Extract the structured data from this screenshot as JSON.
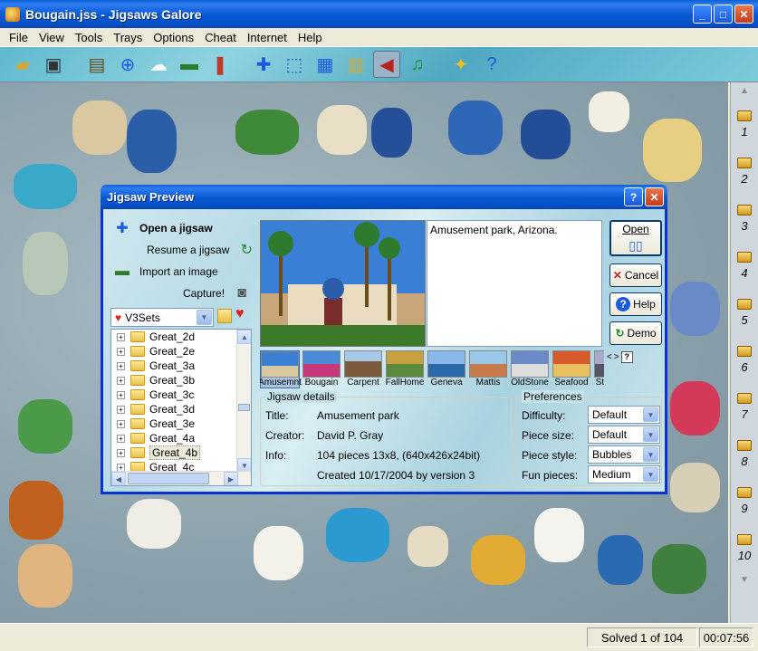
{
  "window": {
    "title": "Bougain.jss - Jigsaws Galore",
    "minimize_icon": "minimize-icon",
    "maximize_icon": "maximize-icon",
    "close_icon": "close-icon"
  },
  "menu": [
    "File",
    "View",
    "Tools",
    "Trays",
    "Options",
    "Cheat",
    "Internet",
    "Help"
  ],
  "toolbar": {
    "icons": [
      "open-folder-icon",
      "save-icon",
      "picture-icon",
      "zoom-icon",
      "ghost-icon",
      "landscape-icon",
      "crayons-icon",
      "pieces-icon",
      "border-select-icon",
      "grid-icon",
      "tray-icon",
      "sound-off-icon",
      "music-icon",
      "hint-icon",
      "help-icon"
    ]
  },
  "tray": {
    "slots": [
      "1",
      "2",
      "3",
      "4",
      "5",
      "6",
      "7",
      "8",
      "9",
      "10"
    ]
  },
  "status": {
    "solved": "Solved 1 of 104",
    "time": "00:07:56"
  },
  "dialog": {
    "title": "Jigsaw Preview",
    "open_jigsaw": "Open a jigsaw",
    "resume_jigsaw": "Resume a jigsaw",
    "import_image": "Import an image",
    "capture": "Capture!",
    "set_combo": "V3Sets",
    "tree_items": [
      "Great_2d",
      "Great_2e",
      "Great_3a",
      "Great_3b",
      "Great_3c",
      "Great_3d",
      "Great_3e",
      "Great_4a",
      "Great_4b",
      "Great_4c"
    ],
    "selected_tree_item": "Great_4b",
    "description": "Amusement park, Arizona.",
    "buttons": {
      "open": "Open",
      "cancel": "Cancel",
      "help": "Help",
      "demo": "Demo"
    },
    "thumbnails": [
      "Amusemnt",
      "Bougain",
      "Carpent",
      "FallHome",
      "Geneva",
      "Mattis",
      "OldStone",
      "Seafood",
      "Stlv"
    ],
    "selected_thumbnail": "Amusemnt",
    "thumb_nav": [
      "<",
      ">",
      "?"
    ],
    "details": {
      "group_label": "Jigsaw details",
      "title_label": "Title:",
      "title_value": "Amusement park",
      "creator_label": "Creator:",
      "creator_value": "David P. Gray",
      "info_label": "Info:",
      "info_value": "104 pieces 13x8, (640x426x24bit)",
      "created": "Created 10/17/2004 by version 3"
    },
    "preferences": {
      "group_label": "Preferences",
      "difficulty_label": "Difficulty:",
      "difficulty_value": "Default",
      "piece_size_label": "Piece size:",
      "piece_size_value": "Default",
      "piece_style_label": "Piece style:",
      "piece_style_value": "Bubbles",
      "fun_pieces_label": "Fun pieces:",
      "fun_pieces_value": "Medium"
    }
  },
  "colors": {
    "title_blue": "#0a5bd6",
    "dialog_border": "#0831d9",
    "workspace": "#8aa0aa"
  }
}
